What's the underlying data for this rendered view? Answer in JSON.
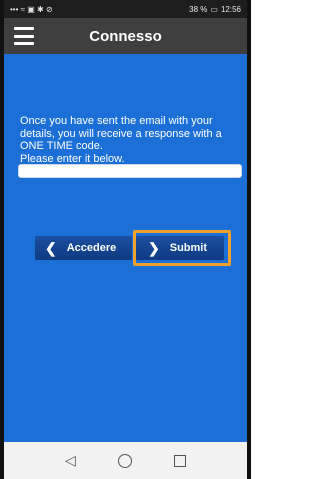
{
  "status_bar": {
    "signal_icons": "••• ≈ ▣ ✱ ⊘",
    "battery": "38 %",
    "time": "12:56"
  },
  "app_bar": {
    "title": "Connesso"
  },
  "main": {
    "message_lines": [
      "Once you have sent the email with your",
      "details, you will receive a response with a",
      "ONE TIME code.",
      "Please enter it below."
    ],
    "code_input_value": "",
    "back_button_label": "Accedere",
    "submit_button_label": "Submit"
  },
  "colors": {
    "main_bg": "#1c6fd6",
    "highlight": "#f0a12e",
    "appbar": "#3f3f3f"
  }
}
